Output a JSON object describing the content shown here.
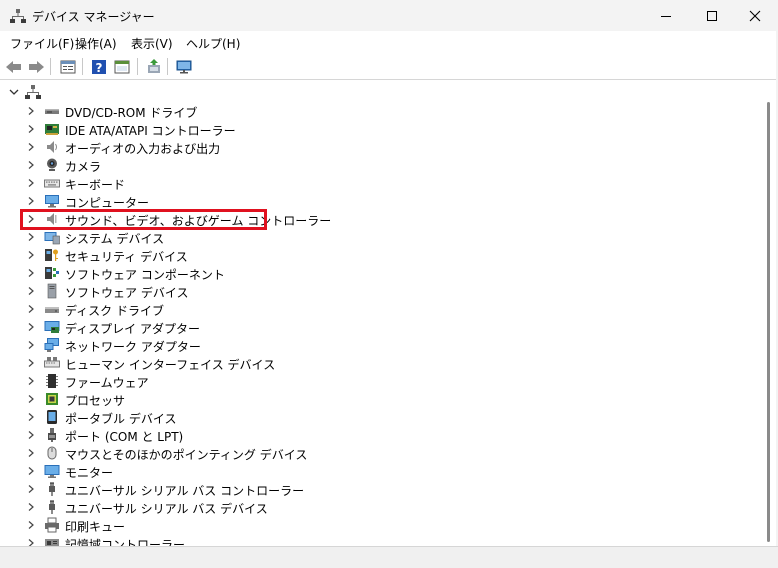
{
  "window": {
    "title": "デバイス マネージャー",
    "app_icon": "device-manager-icon",
    "controls": [
      "minimize-icon",
      "maximize-icon",
      "close-icon"
    ]
  },
  "menu": [
    {
      "label": "ファイル(F)"
    },
    {
      "label": "操作(A)"
    },
    {
      "label": "表示(V)"
    },
    {
      "label": "ヘルプ(H)"
    }
  ],
  "toolbar": [
    "back-icon",
    "forward-icon",
    "properties-icon",
    "help-icon",
    "show-hide-icon",
    "update-driver-icon",
    "scan-hardware-icon"
  ],
  "tree": {
    "root_icon": "computer-root-icon",
    "items": [
      {
        "label": "DVD/CD-ROM ドライブ",
        "icon": "dvd-drive-icon"
      },
      {
        "label": "IDE ATA/ATAPI コントローラー",
        "icon": "ide-controller-icon"
      },
      {
        "label": "オーディオの入力および出力",
        "icon": "speaker-icon"
      },
      {
        "label": "カメラ",
        "icon": "camera-icon"
      },
      {
        "label": "キーボード",
        "icon": "keyboard-icon"
      },
      {
        "label": "コンピューター",
        "icon": "computer-icon"
      },
      {
        "label": "サウンド、ビデオ、およびゲーム コントローラー",
        "icon": "sound-icon"
      },
      {
        "label": "システム デバイス",
        "icon": "system-device-icon"
      },
      {
        "label": "セキュリティ デバイス",
        "icon": "security-device-icon"
      },
      {
        "label": "ソフトウェア コンポーネント",
        "icon": "software-component-icon"
      },
      {
        "label": "ソフトウェア デバイス",
        "icon": "software-device-icon"
      },
      {
        "label": "ディスク ドライブ",
        "icon": "disk-drive-icon"
      },
      {
        "label": "ディスプレイ アダプター",
        "icon": "display-adapter-icon"
      },
      {
        "label": "ネットワーク アダプター",
        "icon": "network-adapter-icon"
      },
      {
        "label": "ヒューマン インターフェイス デバイス",
        "icon": "hid-icon"
      },
      {
        "label": "ファームウェア",
        "icon": "firmware-icon"
      },
      {
        "label": "プロセッサ",
        "icon": "processor-icon"
      },
      {
        "label": "ポータブル デバイス",
        "icon": "portable-device-icon"
      },
      {
        "label": "ポート (COM と LPT)",
        "icon": "port-icon"
      },
      {
        "label": "マウスとそのほかのポインティング デバイス",
        "icon": "mouse-icon"
      },
      {
        "label": "モニター",
        "icon": "monitor-icon"
      },
      {
        "label": "ユニバーサル シリアル バス コントローラー",
        "icon": "usb-controller-icon"
      },
      {
        "label": "ユニバーサル シリアル バス デバイス",
        "icon": "usb-device-icon"
      },
      {
        "label": "印刷キュー",
        "icon": "printer-icon"
      },
      {
        "label": "記憶域コントローラー",
        "icon": "storage-controller-icon"
      }
    ]
  },
  "highlight_color": "#e0111f"
}
